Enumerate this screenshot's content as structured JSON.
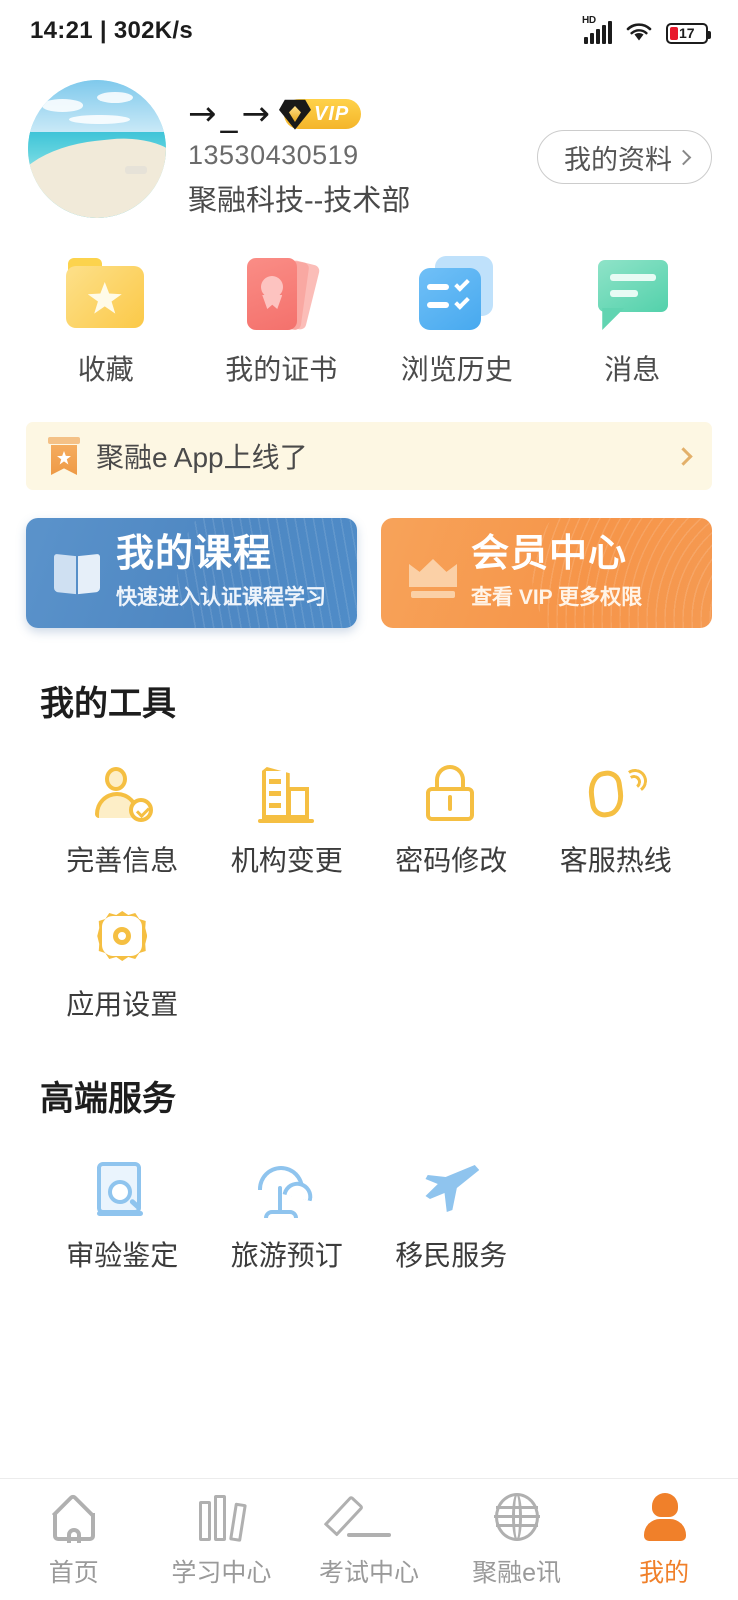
{
  "status_bar": {
    "time": "14:21 | 302K/s",
    "network_type": "HD",
    "battery_percent": "17",
    "icons": [
      "hd-signal-icon",
      "wifi-icon",
      "battery-icon"
    ]
  },
  "profile": {
    "avatar_alt": "beach-avatar",
    "display_name": "→_→",
    "vip_label": "VIP",
    "phone": "13530430519",
    "organization": "聚融科技--技术部",
    "profile_button": "我的资料"
  },
  "quick_actions": [
    {
      "label": "收藏",
      "icon": "folder-star-icon"
    },
    {
      "label": "我的证书",
      "icon": "certificate-icon"
    },
    {
      "label": "浏览历史",
      "icon": "checklist-icon"
    },
    {
      "label": "消息",
      "icon": "chat-bubble-icon"
    }
  ],
  "announcement": {
    "text": "聚融e App上线了",
    "icon": "bookmark-star-icon"
  },
  "banners": [
    {
      "title": "我的课程",
      "subtitle": "快速进入认证课程学习",
      "icon": "open-book-icon",
      "color": "#4e87c2"
    },
    {
      "title": "会员中心",
      "subtitle": "查看 VIP 更多权限",
      "icon": "crown-icon",
      "color": "#f69549"
    }
  ],
  "my_tools": {
    "title": "我的工具",
    "items": [
      {
        "label": "完善信息",
        "icon": "user-check-icon"
      },
      {
        "label": "机构变更",
        "icon": "building-icon"
      },
      {
        "label": "密码修改",
        "icon": "lock-icon"
      },
      {
        "label": "客服热线",
        "icon": "phone-call-icon"
      },
      {
        "label": "应用设置",
        "icon": "gear-icon"
      }
    ]
  },
  "premium_services": {
    "title": "高端服务",
    "items": [
      {
        "label": "审验鉴定",
        "icon": "document-search-icon"
      },
      {
        "label": "旅游预订",
        "icon": "beach-umbrella-icon"
      },
      {
        "label": "移民服务",
        "icon": "airplane-icon"
      }
    ]
  },
  "bottom_nav": {
    "active_index": 4,
    "active_color": "#f0802a",
    "items": [
      {
        "label": "首页",
        "icon": "home-icon"
      },
      {
        "label": "学习中心",
        "icon": "books-icon"
      },
      {
        "label": "考试中心",
        "icon": "pencil-icon"
      },
      {
        "label": "聚融e讯",
        "icon": "globe-icon"
      },
      {
        "label": "我的",
        "icon": "person-icon"
      }
    ]
  }
}
